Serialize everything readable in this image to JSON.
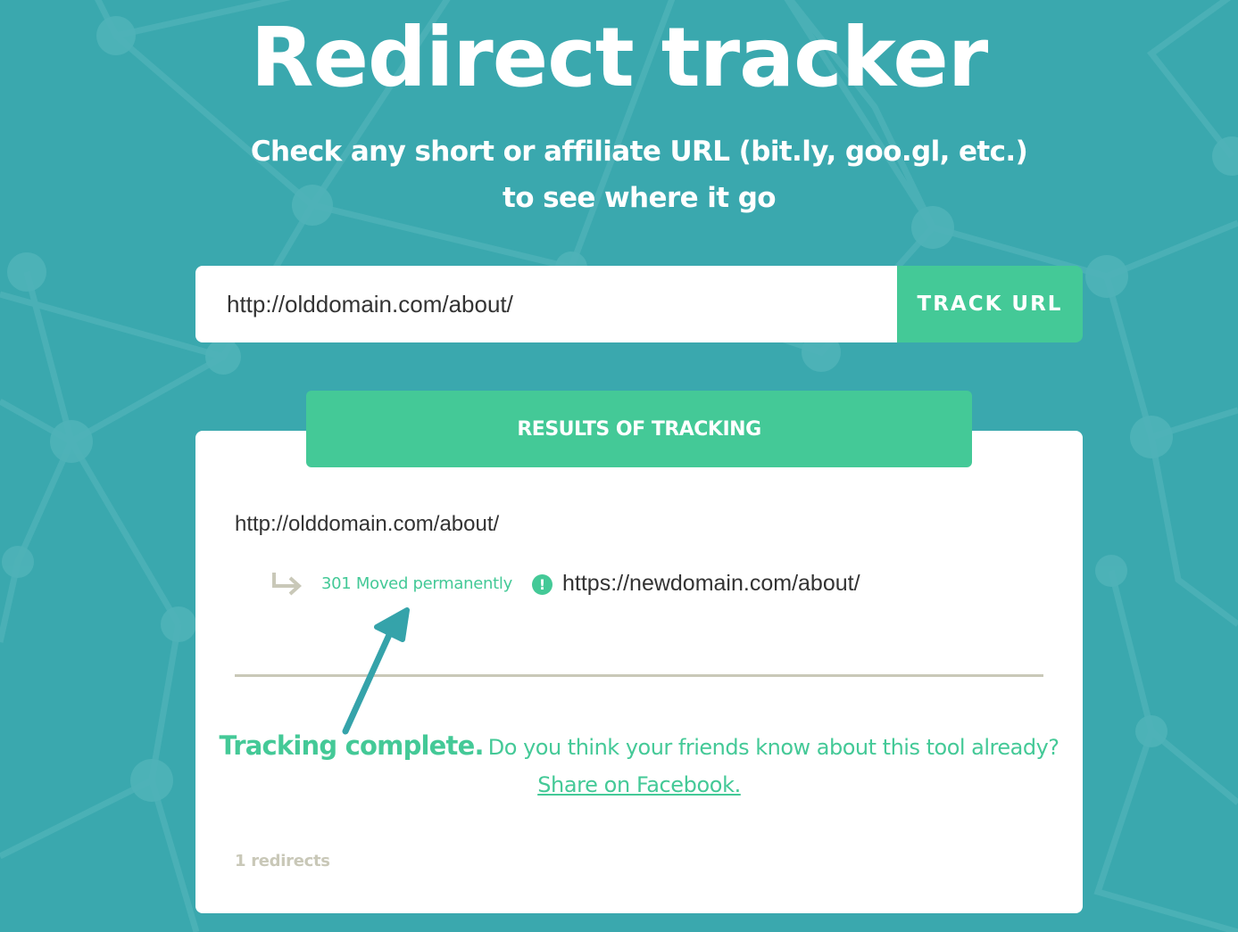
{
  "hero": {
    "title": "Redirect tracker",
    "subtitle": "Check any short or affiliate URL (bit.ly, goo.gl, etc.) to see where it go"
  },
  "search": {
    "value": "http://olddomain.com/about/",
    "button_label": "TRACK URL"
  },
  "results": {
    "header": "RESULTS OF TRACKING",
    "source_url": "http://olddomain.com/about/",
    "redirects": [
      {
        "status": "301 Moved permanently",
        "info_icon": "!",
        "target_url": "https://newdomain.com/about/"
      }
    ],
    "complete_strong": "Tracking complete.",
    "complete_text": "Do you think your friends know about this tool already?",
    "share_link": "Share on Facebook.",
    "count_label": "1 redirects"
  },
  "icons": {
    "redirect": "arrow-turn-right-icon",
    "info": "exclamation-circle-icon",
    "annotation": "annotation-arrow-icon"
  },
  "colors": {
    "background": "#3aa8ae",
    "accent": "#44c997",
    "text": "#333333",
    "muted": "#c9c8b8",
    "card": "#ffffff"
  }
}
